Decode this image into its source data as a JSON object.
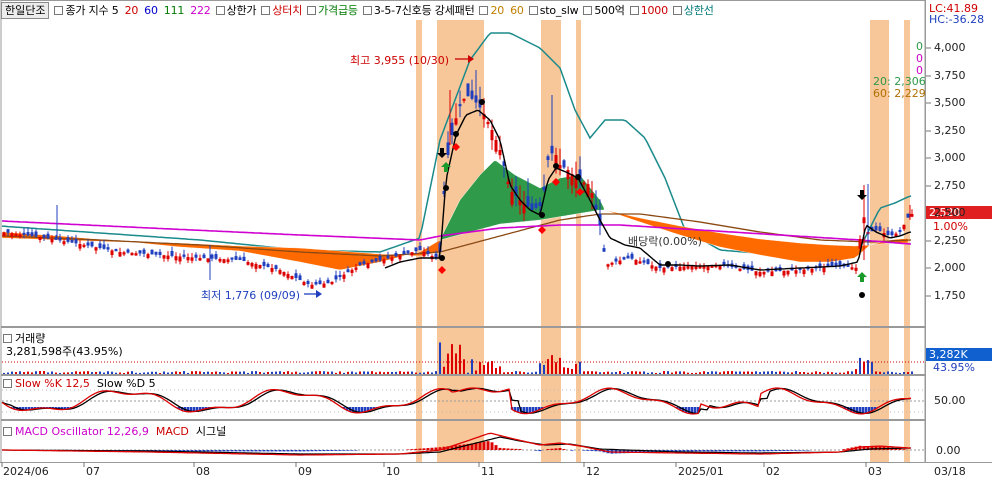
{
  "toolbar": {
    "stock_name": "한일단조",
    "items": [
      {
        "label": "종가 지수 5",
        "color": "#000000"
      },
      {
        "label": "20",
        "color": "#cc0000"
      },
      {
        "label": "60",
        "color": "#0000cc"
      },
      {
        "label": "111",
        "color": "#007a00"
      },
      {
        "label": "222",
        "color": "#cc00cc"
      },
      {
        "label": "상한가",
        "color": "#000000"
      },
      {
        "label": "상터치",
        "color": "#cc0000"
      },
      {
        "label": "가격급등",
        "color": "#007a00"
      },
      {
        "label": "3-5-7신호등 강세패턴",
        "color": "#000000"
      },
      {
        "label": "20",
        "color": "#c08000"
      },
      {
        "label": "60",
        "color": "#c08000"
      },
      {
        "label": "sto_slw",
        "color": "#000000"
      },
      {
        "label": "500억",
        "color": "#000000"
      },
      {
        "label": "1000",
        "color": "#cc0000"
      },
      {
        "label": "상한선",
        "color": "#007a7a"
      }
    ]
  },
  "price_panel": {
    "axis_ticks": [
      "4,000",
      "3,750",
      "3,500",
      "3,250",
      "3,000",
      "2,750",
      "2,500",
      "2,250",
      "2,000",
      "1,750"
    ],
    "lc_label": "LC:41.89",
    "hc_label": "HC:-36.28",
    "current_price": "2,520",
    "change_pct": "1.00%",
    "high_annotation": "최고 3,955 (10/30)",
    "low_annotation": "최저 1,776 (09/09)",
    "dividend_annotation": "배당락(0.00%)",
    "legend_zero_1": "0",
    "legend_zero_2": "0",
    "legend_zero_3": "0",
    "legend_ma20": "20: 2,306",
    "legend_ma60": "60: 2,229"
  },
  "volume_panel": {
    "title": "거래량",
    "value": "3,281,598주(43.95%)",
    "tag_value": "3,282K",
    "tag_pct": "43.95%"
  },
  "stoch_panel": {
    "title_k": "Slow %K 12,5",
    "title_d": "Slow %D 5",
    "axis_tick": "50.00"
  },
  "macd_panel": {
    "title_osc": "MACD Oscillator 12,26,9",
    "title_macd": "MACD",
    "title_signal": "시그널",
    "axis_tick": "0.00"
  },
  "date_axis": [
    "2024/06",
    "07",
    "08",
    "09",
    "10",
    "11",
    "12",
    "2025/01",
    "02",
    "03",
    "03/18"
  ],
  "colors": {
    "up": "#dd0000",
    "down": "#1f3fbf",
    "highlight": "#f7c79a",
    "price_tag": "#e02020",
    "volume_tag": "#1060d0",
    "ma222": "#d000d0",
    "upper_band": "#1a8a8a",
    "ribbon_orange": "#ff6a00",
    "ribbon_green": "#2e9a4a"
  }
}
